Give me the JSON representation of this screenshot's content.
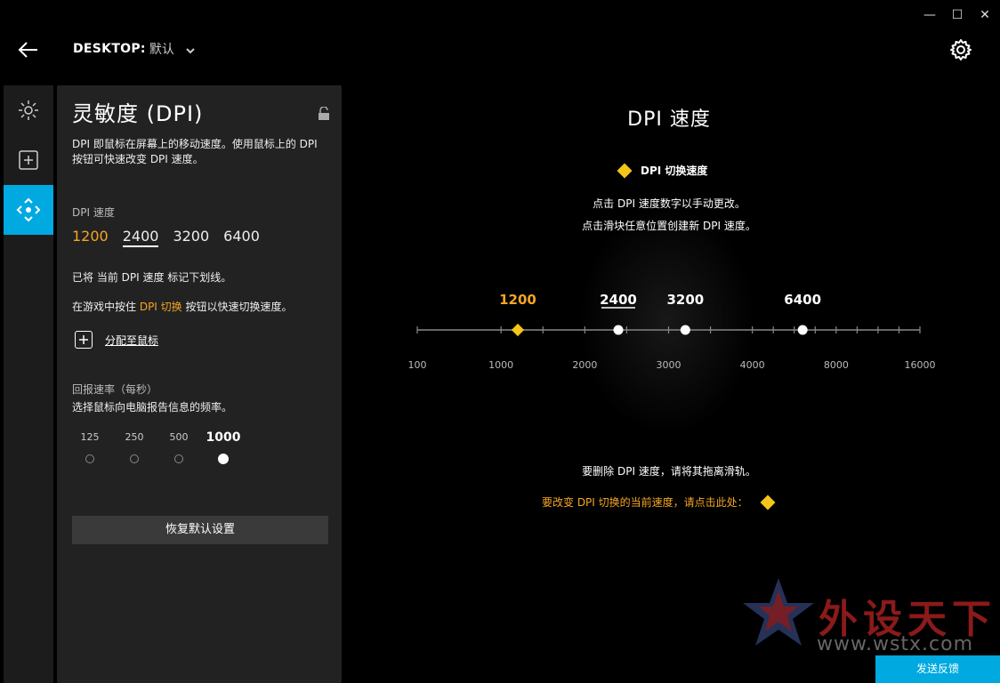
{
  "window": {
    "minimize": "—",
    "maximize": "☐",
    "close": "✕"
  },
  "header": {
    "profile_label": "DESKTOP:",
    "profile_value": "默认"
  },
  "panel": {
    "title": "灵敏度 (DPI)",
    "description": "DPI 即鼠标在屏幕上的移动速度。使用鼠标上的 DPI 按钮可快速改变 DPI 速度。",
    "dpi_label": "DPI 速度",
    "dpi_values": [
      "1200",
      "2400",
      "3200",
      "6400"
    ],
    "current_note": "已将 当前 DPI 速度 标记下划线。",
    "switch_note_pre": "在游戏中按住 ",
    "switch_note_hl": "DPI 切换",
    "switch_note_post": " 按钮以快速切换速度。",
    "assign_label": "分配至鼠标",
    "rate_title": "回报速率（每秒）",
    "rate_desc": "选择鼠标向电脑报告信息的频率。",
    "rates": [
      "125",
      "250",
      "500",
      "1000"
    ],
    "reset_label": "恢复默认设置"
  },
  "main": {
    "title": "DPI 速度",
    "switch_legend": "DPI 切换速度",
    "instr1": "点击 DPI 速度数字以手动更改。",
    "instr2": "点击滑块任意位置创建新 DPI 速度。",
    "delete_note": "要删除 DPI 速度，请将其拖离滑轨。",
    "change_switch_note": "要改变 DPI 切换的当前速度，请点击此处："
  },
  "slider": {
    "axis_labels": [
      "100",
      "1000",
      "2000",
      "3000",
      "4000",
      "8000",
      "16000"
    ],
    "stages": [
      "1200",
      "2400",
      "3200",
      "6400"
    ],
    "switch_stage": "1200",
    "current_stage": "2400"
  },
  "watermark": {
    "text": "外设天下",
    "url": "www.wstx.com"
  },
  "feedback_label": "发送反馈",
  "colors": {
    "accent": "#00a9e0",
    "switch": "#f5a623",
    "diamond": "#f5c518"
  }
}
